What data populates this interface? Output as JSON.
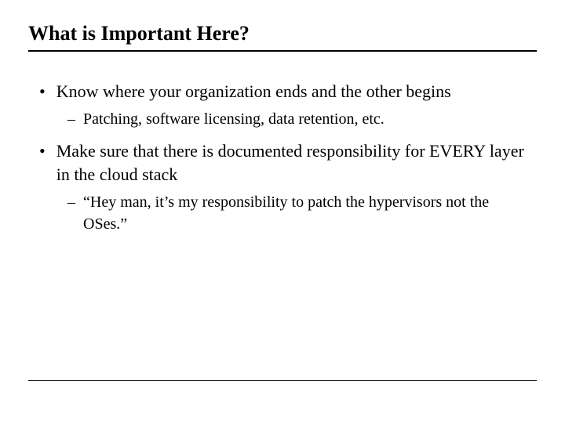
{
  "title": "What is Important Here?",
  "bullets": [
    {
      "text": "Know where your organization ends and the other begins",
      "subs": [
        "Patching, software licensing, data retention, etc."
      ]
    },
    {
      "text": "Make sure that there is documented responsibility for EVERY layer in the cloud stack",
      "subs": [
        "“Hey man, it’s my responsibility to patch the hypervisors not the OSes.”"
      ]
    }
  ]
}
